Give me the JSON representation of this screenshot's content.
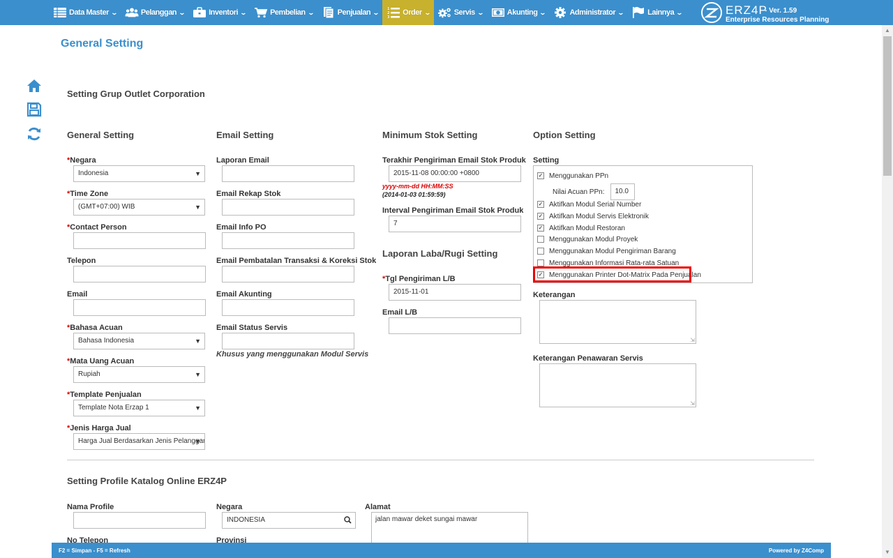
{
  "nav": {
    "items": [
      {
        "label": "Data Master",
        "icon": "list-icon"
      },
      {
        "label": "Pelanggan",
        "icon": "users-icon"
      },
      {
        "label": "Inventori",
        "icon": "briefcase-icon"
      },
      {
        "label": "Pembelian",
        "icon": "cart-icon"
      },
      {
        "label": "Penjualan",
        "icon": "document-icon"
      },
      {
        "label": "Order",
        "icon": "ordered-list-icon"
      },
      {
        "label": "Servis",
        "icon": "gears-icon"
      },
      {
        "label": "Akunting",
        "icon": "money-icon"
      },
      {
        "label": "Administrator",
        "icon": "gear-icon"
      },
      {
        "label": "Lainnya",
        "icon": "flag-icon"
      }
    ],
    "active_index": 5
  },
  "brand": {
    "name": "ERZ4P",
    "version": "- Ver. 1.59",
    "subtitle": "Enterprise Resources Planning"
  },
  "page": {
    "title": "General Setting"
  },
  "toolbar": {
    "icons": [
      "home-icon",
      "save-icon",
      "refresh-icon"
    ]
  },
  "section1": {
    "title": "Setting Grup Outlet Corporation"
  },
  "general": {
    "title": "General Setting",
    "negara_label": "Negara",
    "negara_value": "Indonesia",
    "timezone_label": "Time Zone",
    "timezone_value": "(GMT+07:00) WIB",
    "contact_label": "Contact Person",
    "contact_value": "",
    "telepon_label": "Telepon",
    "telepon_value": "",
    "email_label": "Email",
    "email_value": "",
    "bahasa_label": "Bahasa Acuan",
    "bahasa_value": "Bahasa Indonesia",
    "mata_uang_label": "Mata Uang Acuan",
    "mata_uang_value": "Rupiah",
    "template_label": "Template Penjualan",
    "template_value": "Template Nota Erzap 1",
    "jenis_harga_label": "Jenis Harga Jual",
    "jenis_harga_value": "Harga Jual Berdasarkan Jenis Pelanggar"
  },
  "email_setting": {
    "title": "Email Setting",
    "laporan_label": "Laporan Email",
    "rekap_stok_label": "Email Rekap Stok",
    "info_po_label": "Email Info PO",
    "pembatalan_label": "Email Pembatalan Transaksi & Koreksi Stok",
    "akunting_label": "Email Akunting",
    "status_servis_label": "Email Status Servis",
    "note": "Khusus yang menggunakan Modul Servis"
  },
  "min_stok": {
    "title": "Minimum Stok Setting",
    "terakhir_label": "Terakhir Pengiriman Email Stok Produk",
    "terakhir_value": "2015-11-08 00:00:00 +0800",
    "format_hint": "yyyy-mm-dd HH:MM:SS",
    "format_example": "(2014-01-03 01:59:59)",
    "interval_label": "Interval Pengiriman Email Stok Produk",
    "interval_value": "7"
  },
  "laba_rugi": {
    "title": "Laporan Laba/Rugi Setting",
    "tgl_label": "Tgl Pengiriman L/B",
    "tgl_value": "2015-11-01",
    "email_label": "Email L/B",
    "email_value": ""
  },
  "option": {
    "title": "Option Setting",
    "setting_label": "Setting",
    "items": [
      {
        "label": "Menggunakan PPn",
        "checked": true
      },
      {
        "label": "Aktifkan Modul Serial Number",
        "checked": true
      },
      {
        "label": "Aktifkan Modul Servis Elektronik",
        "checked": true
      },
      {
        "label": "Aktifkan Modul Restoran",
        "checked": true
      },
      {
        "label": "Menggunakan Modul Proyek",
        "checked": false
      },
      {
        "label": "Menggunakan Modul Pengiriman Barang",
        "checked": false
      },
      {
        "label": "Menggunakan Informasi Rata-rata Satuan",
        "checked": false
      },
      {
        "label": "Menggunakan Printer Dot-Matrix Pada Penjualan",
        "checked": true
      }
    ],
    "ppn_label": "Nilai Acuan PPn:",
    "ppn_value": "10.0",
    "keterangan_label": "Keterangan",
    "keterangan_servis_label": "Keterangan Penawaran Servis"
  },
  "section2": {
    "title": "Setting Profile Katalog Online ERZ4P",
    "nama_profile_label": "Nama Profile",
    "nama_profile_value": "",
    "negara_label": "Negara",
    "negara_value": "INDONESIA",
    "alamat_label": "Alamat",
    "alamat_value": "jalan mawar deket sungai mawar",
    "no_telepon_label": "No Telepon",
    "provinsi_label": "Provinsi"
  },
  "footer": {
    "shortcuts": "F2 = Simpan - F5 = Refresh",
    "powered": "Powered by Z4Comp"
  },
  "colors": {
    "nav": "#3b8fcd",
    "nav_active": "#c8b12c",
    "required": "#dd0000",
    "highlight": "#ee0000"
  }
}
